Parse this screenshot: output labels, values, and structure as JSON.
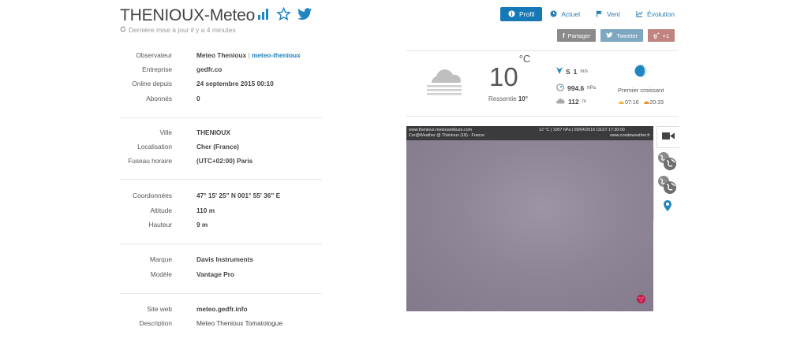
{
  "header": {
    "title": "THENIOUX-Meteo",
    "updated": "Dernière mise à jour il y a 4 minutes",
    "icons": [
      "bar-chart-icon",
      "star-icon",
      "twitter-icon"
    ]
  },
  "nav": {
    "items": [
      {
        "label": "Profil",
        "icon": "info-icon",
        "active": true
      },
      {
        "label": "Actuel",
        "icon": "clock-icon"
      },
      {
        "label": "Vent",
        "icon": "flag-icon"
      },
      {
        "label": "Évolution",
        "icon": "line-chart-icon"
      }
    ]
  },
  "share": {
    "facebook": "Partager",
    "twitter": "Tweeter",
    "gplus": "+1"
  },
  "info": {
    "observateur": {
      "label": "Observateur",
      "name": "Meteo Thenioux",
      "sep": "|",
      "handle": "meteo-thenioux"
    },
    "entreprise": {
      "label": "Entreprise",
      "value": "gedfr.co"
    },
    "online": {
      "label": "Online depuis",
      "value": "24 septembre 2015 00:10"
    },
    "abonnes": {
      "label": "Abonnés",
      "value": "0"
    },
    "ville": {
      "label": "Ville",
      "value": "THENIOUX"
    },
    "localisation": {
      "label": "Localisation",
      "value": "Cher (France)"
    },
    "fuseau": {
      "label": "Fuseau horaire",
      "value": "(UTC+02:00) Paris"
    },
    "coordonnees": {
      "label": "Coordonnées",
      "value": "47° 15' 25\" N  001° 55' 36\" E"
    },
    "altitude": {
      "label": "Altitude",
      "value": "110 m"
    },
    "hauteur": {
      "label": "Hauteur",
      "value": "9 m"
    },
    "marque": {
      "label": "Marque",
      "value": "Davis Instruments"
    },
    "modele": {
      "label": "Modèle",
      "value": "Vantage Pro"
    },
    "site": {
      "label": "Site web",
      "value": "meteo.gedfr.info"
    },
    "description": {
      "label": "Description",
      "value": "Meteo Thenioux Tomatologue"
    }
  },
  "weather": {
    "temp": "10",
    "temp_unit": "°C",
    "ressentie_label": "Ressentie",
    "ressentie_value": "10°",
    "wind_dir": "S",
    "wind_speed": "1",
    "wind_unit": "m/s",
    "pressure": "994.6",
    "pressure_unit": "hPa",
    "cloud_base": "112",
    "cloud_unit": "m",
    "moon": "Premier croissant",
    "sunrise": "07:16",
    "sunset": "20:33",
    "icon": "cloud-icon"
  },
  "webcam": {
    "site": "www.thenioux.meteoamikuze.com",
    "line2": "Cre@Weather @ Thénioux (18) - France",
    "status": "12 °C  |  1007 hPa  |  09/04/2016 CEST 17:30:00",
    "credit": "www.createweather.fr"
  },
  "colors": {
    "accent": "#1579b8",
    "link": "#2080b8",
    "facebook": "#8a8a8a",
    "twitter": "#7fa7c0",
    "gplus": "#c0847f"
  }
}
